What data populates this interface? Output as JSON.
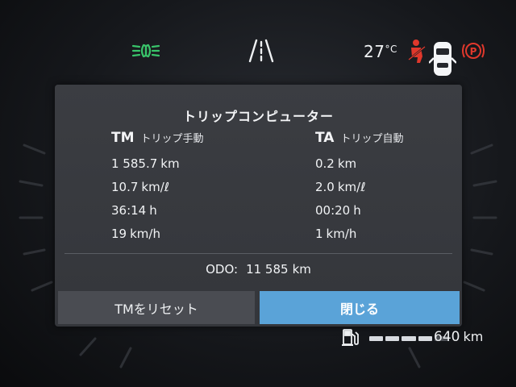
{
  "status_bar": {
    "icons": [
      "headlight-icon",
      "lane-assist-icon",
      "seatbelt-warning-icon",
      "car-doors-icon",
      "parking-brake-icon"
    ],
    "temperature_value": "27",
    "temperature_unit": "°C",
    "colors": {
      "headlight": "#39c46a",
      "warning": "#e0382c",
      "text": "#f1f3f5"
    }
  },
  "trip_computer": {
    "title": "トリップコンピューター",
    "tm": {
      "code": "TM",
      "mode": "トリップ手動",
      "distance": {
        "value": "1 585.7",
        "unit": "km"
      },
      "fuel_economy": {
        "value": "10.7",
        "unit": "km/ℓ"
      },
      "time": {
        "value": "36:14",
        "unit": "h"
      },
      "avg_speed": {
        "value": "19",
        "unit": "km/h"
      }
    },
    "ta": {
      "code": "TA",
      "mode": "トリップ自動",
      "distance": {
        "value": "0.2",
        "unit": "km"
      },
      "fuel_economy": {
        "value": "2.0",
        "unit": "km/ℓ"
      },
      "time": {
        "value": "00:20",
        "unit": "h"
      },
      "avg_speed": {
        "value": "1",
        "unit": "km/h"
      }
    },
    "odo": {
      "label": "ODO:",
      "value": "11 585",
      "unit": "km"
    },
    "buttons": {
      "reset_label": "TMをリセット",
      "close_label": "閉じる"
    },
    "colors": {
      "panel": "#393b40",
      "close_button": "#5aa3d8",
      "reset_button": "#4a4c52"
    }
  },
  "fuel": {
    "icon": "fuel-pump-icon",
    "level_fraction": 0.8,
    "range_value": "640",
    "range_unit": "km"
  }
}
